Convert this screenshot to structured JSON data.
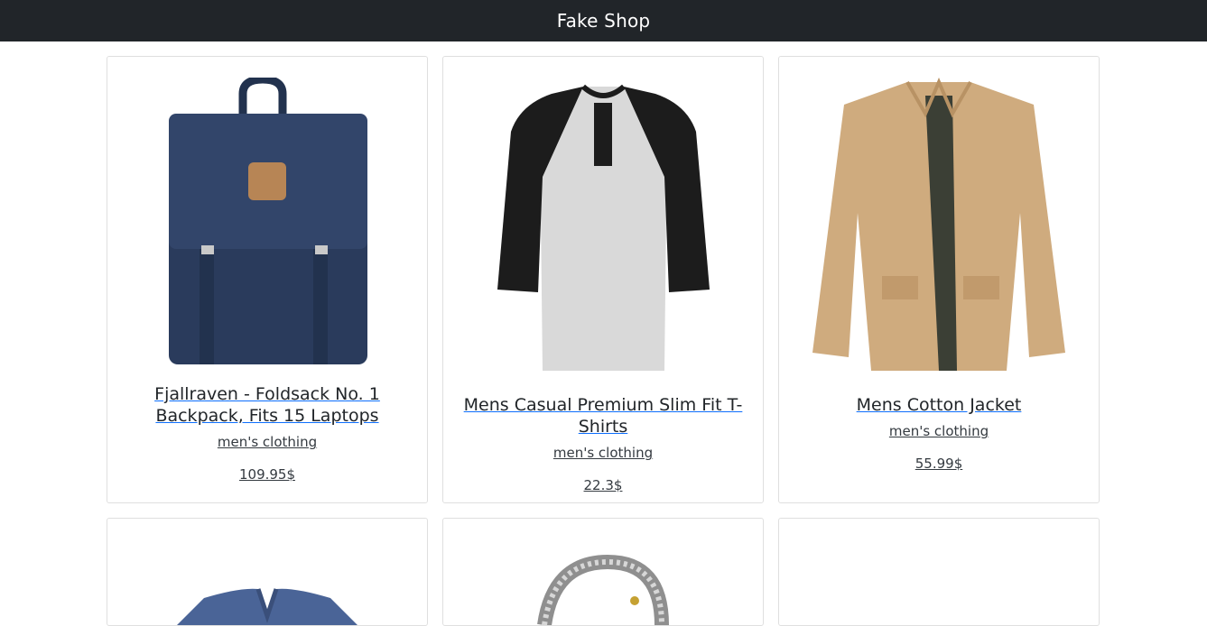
{
  "app": {
    "brand": "Fake Shop"
  },
  "products": [
    {
      "title": "Fjallraven - Foldsack No. 1 Backpack, Fits 15 Laptops",
      "category": "men's clothing",
      "price": "109.95$",
      "image_icon": "backpack-image"
    },
    {
      "title": "Mens Casual Premium Slim Fit T-Shirts",
      "category": "men's clothing",
      "price": "22.3$",
      "image_icon": "raglan-tshirt-image"
    },
    {
      "title": "Mens Cotton Jacket",
      "category": "men's clothing",
      "price": "55.99$",
      "image_icon": "cotton-jacket-image"
    },
    {
      "image_icon": "vneck-tshirt-image"
    },
    {
      "image_icon": "chain-bracelet-image"
    },
    {
      "image_icon": ""
    }
  ],
  "colors": {
    "navbar": "#212529",
    "link_underline": "#0d6efd"
  }
}
